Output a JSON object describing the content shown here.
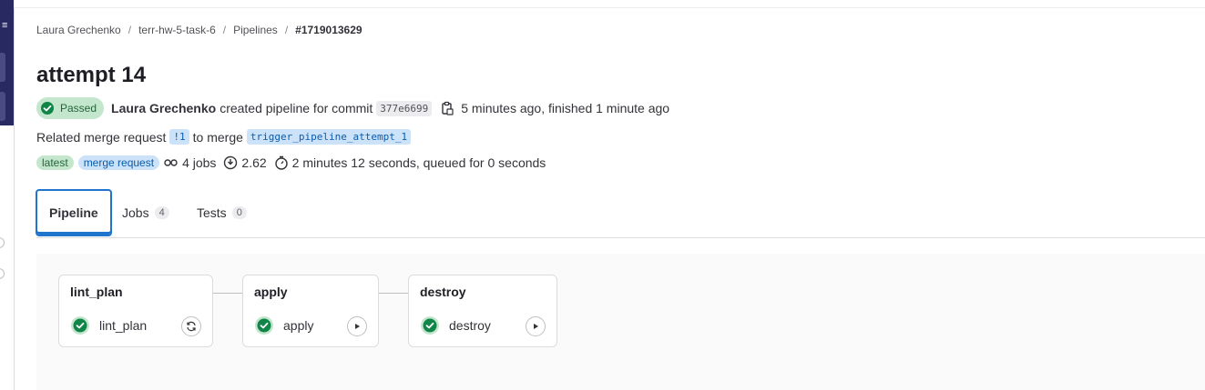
{
  "breadcrumb": {
    "items": [
      "Laura Grechenko",
      "terr-hw-5-task-6",
      "Pipelines"
    ],
    "current": "#1719013629",
    "separator": "/"
  },
  "pipeline": {
    "title": "attempt 14",
    "status": "Passed",
    "author": "Laura Grechenko",
    "created_text": "created pipeline for commit",
    "commit_sha": "377e6699",
    "timing_text": "5 minutes ago, finished 1 minute ago",
    "related_mr_prefix": "Related merge request",
    "mr_id": "!1",
    "to_merge": "to merge",
    "branch": "trigger_pipeline_attempt_1",
    "badges": [
      "latest",
      "merge request"
    ],
    "jobs_count": "4 jobs",
    "compute": "2.62",
    "duration": "2 minutes 12 seconds, queued for 0 seconds"
  },
  "tabs": [
    {
      "label": "Pipeline",
      "count": null,
      "active": true
    },
    {
      "label": "Jobs",
      "count": "4",
      "active": false
    },
    {
      "label": "Tests",
      "count": "0",
      "active": false
    }
  ],
  "stages": [
    {
      "name": "lint_plan",
      "job": "lint_plan",
      "status": "success",
      "action": "retry-icon"
    },
    {
      "name": "apply",
      "job": "apply",
      "status": "success",
      "action": "play-icon"
    },
    {
      "name": "destroy",
      "job": "destroy",
      "status": "success",
      "action": "play-icon"
    }
  ],
  "colors": {
    "success": "#108548",
    "accent": "#1f75cb",
    "sidebar": "#292961"
  }
}
